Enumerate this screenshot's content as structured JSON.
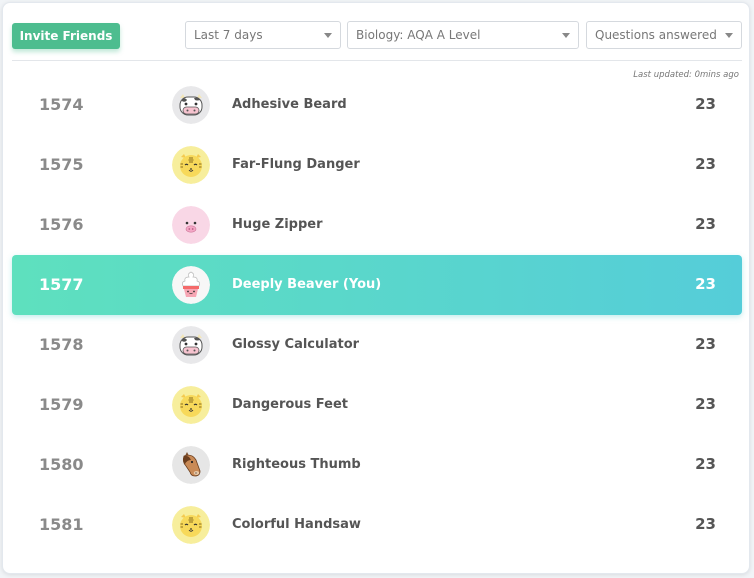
{
  "toolbar": {
    "invite_label": "Invite Friends",
    "range": "Last 7 days",
    "subject": "Biology: AQA A Level",
    "metric": "Questions answered"
  },
  "last_updated": "Last updated: 0mins ago",
  "leaderboard": [
    {
      "rank": "1574",
      "name": "Adhesive Beard",
      "score": "23",
      "avatar": "cow-icon"
    },
    {
      "rank": "1575",
      "name": "Far-Flung Danger",
      "score": "23",
      "avatar": "tiger-icon"
    },
    {
      "rank": "1576",
      "name": "Huge Zipper",
      "score": "23",
      "avatar": "pig-icon"
    },
    {
      "rank": "1577",
      "name": "Deeply Beaver (You)",
      "score": "23",
      "avatar": "cupcake-icon",
      "current_user": true
    },
    {
      "rank": "1578",
      "name": "Glossy Calculator",
      "score": "23",
      "avatar": "cow-icon"
    },
    {
      "rank": "1579",
      "name": "Dangerous Feet",
      "score": "23",
      "avatar": "tiger-icon"
    },
    {
      "rank": "1580",
      "name": "Righteous Thumb",
      "score": "23",
      "avatar": "horse-icon"
    },
    {
      "rank": "1581",
      "name": "Colorful Handsaw",
      "score": "23",
      "avatar": "tiger-icon"
    }
  ],
  "colors": {
    "accent_green": "#4dbd8f",
    "highlight_start": "#5ee0be",
    "highlight_end": "#55cdd9"
  }
}
